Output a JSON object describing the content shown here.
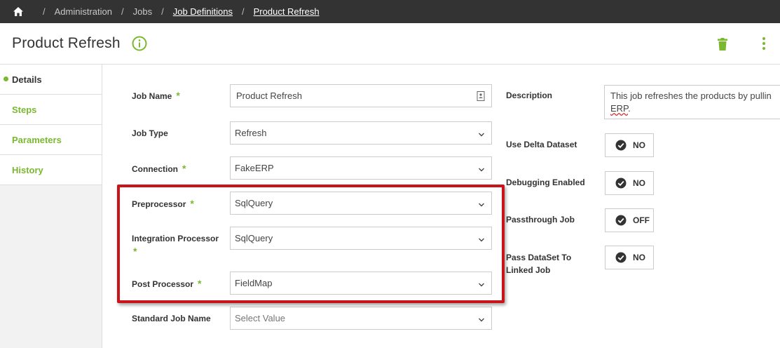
{
  "breadcrumb": {
    "items": [
      {
        "label": "Administration"
      },
      {
        "label": "Jobs"
      },
      {
        "label": "Job Definitions"
      },
      {
        "label": "Product Refresh"
      }
    ],
    "separator": "/"
  },
  "header": {
    "title": "Product Refresh"
  },
  "sidebar": {
    "items": [
      {
        "label": "Details",
        "active": true
      },
      {
        "label": "Steps"
      },
      {
        "label": "Parameters"
      },
      {
        "label": "History"
      }
    ]
  },
  "form": {
    "job_name": {
      "label": "Job Name",
      "value": "Product Refresh",
      "required": "*"
    },
    "job_type": {
      "label": "Job Type",
      "value": "Refresh"
    },
    "connection": {
      "label": "Connection",
      "value": "FakeERP",
      "required": "*"
    },
    "preprocessor": {
      "label": "Preprocessor",
      "value": "SqlQuery",
      "required": "*"
    },
    "integration_processor": {
      "label": "Integration Processor",
      "value": "SqlQuery",
      "required": "*"
    },
    "post_processor": {
      "label": "Post Processor",
      "value": "FieldMap",
      "required": "*"
    },
    "standard_job_name": {
      "label": "Standard Job Name",
      "placeholder": "Select Value"
    }
  },
  "right_form": {
    "description": {
      "label": "Description",
      "text_line1": "This job refreshes the products by pullin",
      "text_line2_wavy": "ERP",
      "text_line2_rest": "."
    },
    "use_delta_dataset": {
      "label": "Use Delta Dataset",
      "value": "NO"
    },
    "debugging_enabled": {
      "label": "Debugging Enabled",
      "value": "NO"
    },
    "passthrough_job": {
      "label": "Passthrough Job",
      "value": "OFF"
    },
    "pass_dataset": {
      "label_line1": "Pass DataSet To",
      "label_line2": "Linked Job",
      "value": "NO"
    }
  },
  "colors": {
    "accent": "#7ab830",
    "topbar": "#333333",
    "highlight": "#c8141a"
  },
  "icons": [
    "home-icon",
    "info-icon",
    "trash-icon",
    "kebab-icon",
    "chevron-down-icon",
    "address-book-icon",
    "check-circle-icon"
  ]
}
